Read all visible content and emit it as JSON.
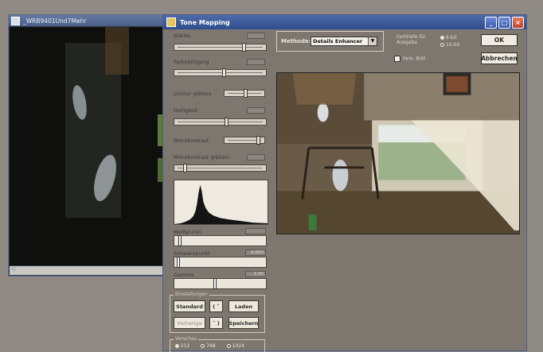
{
  "background_window": {
    "title": "_WRB9401Und7Mehr"
  },
  "dialog": {
    "title": "Tone Mapping",
    "window_buttons": [
      "_",
      "□",
      "×"
    ]
  },
  "sliders": [
    {
      "label": "Stärke",
      "value": "",
      "fill": 0.78
    },
    {
      "label": "Farbsättigung",
      "value": "",
      "fill": 0.55
    },
    {
      "label": "Lichter glätten",
      "value": "",
      "fill": 0.55
    },
    {
      "label": "Helligkeit",
      "value": "",
      "fill": 0.58
    },
    {
      "label": "Mikrokontrast",
      "value": "",
      "fill": 0.9
    },
    {
      "label": "Mikrokontrast glätten",
      "value": "",
      "fill": 0.1
    }
  ],
  "levels": [
    {
      "label": "Weißpunkt",
      "value": "",
      "fill": 0.05
    },
    {
      "label": "Schwarzpunkt",
      "value": "0.000",
      "fill": 0.03
    },
    {
      "label": "Gamma",
      "value": "1.00",
      "fill": 0.45
    }
  ],
  "settings_group": {
    "legend": "Einstellungen",
    "standard": "Standard",
    "laden": "Laden",
    "vorherige": "Vorherige",
    "speichern": "Speichern",
    "undo": "( ˆ",
    "redo": "ˆ )"
  },
  "preview_group": {
    "legend": "Vorschau",
    "options": [
      "512",
      "768",
      "1024"
    ],
    "selected": "512"
  },
  "method": {
    "label": "Methode:",
    "selected": "Details Enhancer"
  },
  "bit_depth": {
    "label_line1": "Farbtiefe für",
    "label_line2": "Ausgabe",
    "options": [
      "8-bit",
      "16-bit"
    ],
    "selected": "8-bit"
  },
  "color_checkbox": {
    "label": "Farb. Bild",
    "checked": false
  },
  "buttons": {
    "ok": "OK",
    "cancel": "Abbrechen"
  }
}
